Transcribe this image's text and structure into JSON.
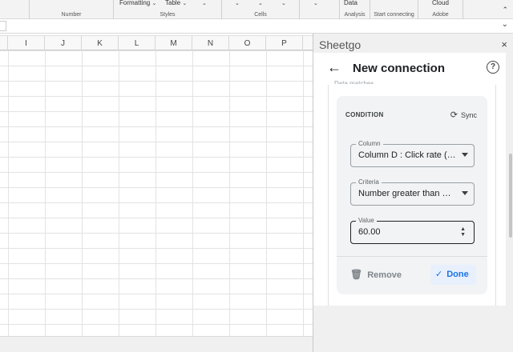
{
  "ribbon": {
    "top_labels": [
      "Formatting",
      "Table",
      "Data",
      "Cloud"
    ],
    "groups": [
      "Number",
      "Styles",
      "Cells",
      "Analysis",
      "Start connecting",
      "Adobe"
    ]
  },
  "sheet": {
    "columns": [
      "I",
      "J",
      "K",
      "L",
      "M",
      "N",
      "O",
      "P"
    ]
  },
  "pane": {
    "title": "Sheetgo",
    "close_glyph": "×",
    "header": {
      "title": "New connection",
      "back_icon": "arrow-left-icon",
      "help_glyph": "?"
    },
    "cut_label": "Data matches",
    "condition": {
      "label": "CONDITION",
      "sync_label": "Sync",
      "sync_glyph": "⟳",
      "column": {
        "label": "Column",
        "value": "Column D : Click rate (…"
      },
      "criteria": {
        "label": "Criteria",
        "value": "Number greater than …"
      },
      "value_field": {
        "label": "Value",
        "value": "60.00"
      },
      "remove_label": "Remove",
      "remove_glyph": "🗑",
      "done_label": "Done",
      "done_glyph": "✓"
    }
  },
  "colors": {
    "accent": "#1a73e8",
    "done_bg": "#e8f0fe",
    "card_bg": "#f1f3f4"
  }
}
